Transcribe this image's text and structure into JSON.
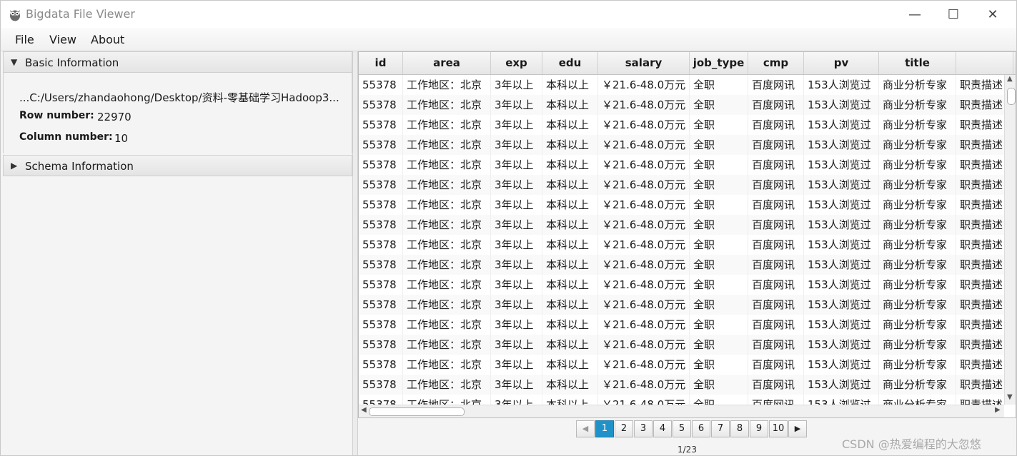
{
  "window": {
    "title": "Bigdata File Viewer",
    "minimize_glyph": "—",
    "maximize_glyph": "☐",
    "close_glyph": "✕"
  },
  "menu": {
    "file": "File",
    "view": "View",
    "about": "About"
  },
  "basic_info": {
    "header": "Basic Information",
    "path": "...C:/Users/zhandaohong/Desktop/资料-零基础学习Hadoop3...",
    "row_label": "Row number:",
    "row_value": "22970",
    "col_label": "Column number:",
    "col_value": "10"
  },
  "schema_info": {
    "header": "Schema Information"
  },
  "table": {
    "columns": [
      "id",
      "area",
      "exp",
      "edu",
      "salary",
      "job_type",
      "cmp",
      "pv",
      "title",
      ""
    ],
    "row": [
      "55378",
      "工作地区：北京",
      "3年以上",
      "本科以上",
      "￥21.6-48.0万元",
      "全职",
      "百度网讯",
      "153人浏览过",
      "商业分析专家",
      "职责描述"
    ],
    "row_count_visible": 17
  },
  "pager": {
    "pages": [
      "1",
      "2",
      "3",
      "4",
      "5",
      "6",
      "7",
      "8",
      "9",
      "10"
    ],
    "active_page": "1",
    "prev_glyph": "◀",
    "next_glyph": "▶",
    "info": "1/23"
  },
  "watermark": "CSDN @热爱编程的大忽悠",
  "colors": {
    "accent": "#1f93c9"
  },
  "icons": {
    "app": "owl-icon",
    "expand": "triangle-down-icon",
    "collapse": "triangle-right-icon"
  }
}
